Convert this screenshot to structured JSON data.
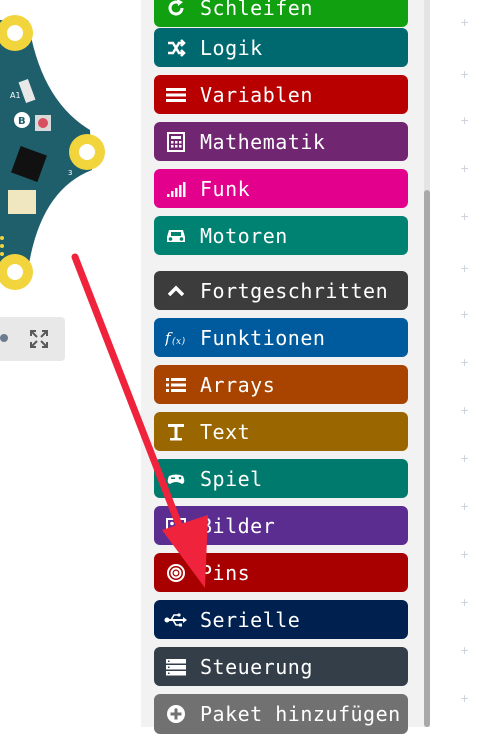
{
  "toolbox": {
    "categories": [
      {
        "label": "Schleifen",
        "icon": "loop-icon",
        "color": "#10a010"
      },
      {
        "label": "Logik",
        "icon": "shuffle-icon",
        "color": "#006970"
      },
      {
        "label": "Variablen",
        "icon": "list-lines-icon",
        "color": "#b80000"
      },
      {
        "label": "Mathematik",
        "icon": "calculator-icon",
        "color": "#712672"
      },
      {
        "label": "Funk",
        "icon": "signal-bars-icon",
        "color": "#e3008c"
      },
      {
        "label": "Motoren",
        "icon": "car-icon",
        "color": "#008272"
      },
      {
        "label": "Fortgeschritten",
        "icon": "chevron-up-icon",
        "color": "#3c3c3c"
      },
      {
        "label": "Funktionen",
        "icon": "function-icon",
        "color": "#005a9e"
      },
      {
        "label": "Arrays",
        "icon": "numbered-list-icon",
        "color": "#a94400"
      },
      {
        "label": "Text",
        "icon": "text-icon",
        "color": "#996600"
      },
      {
        "label": "Spiel",
        "icon": "gamepad-icon",
        "color": "#007a6c"
      },
      {
        "label": "Bilder",
        "icon": "image-icon",
        "color": "#5c2d91"
      },
      {
        "label": "Pins",
        "icon": "target-icon",
        "color": "#a80000"
      },
      {
        "label": "Serielle",
        "icon": "usb-icon",
        "color": "#002050"
      },
      {
        "label": "Steuerung",
        "icon": "server-icon",
        "color": "#333e48"
      },
      {
        "label": "Paket hinzufügen",
        "icon": "plus-circle-icon",
        "color": "#717171"
      }
    ]
  },
  "simulator": {
    "board_labels": {
      "a1": "A1",
      "b": "B",
      "three": "3"
    },
    "accent": "#1f5f6b",
    "fullscreen_icon": "fullscreen-icon"
  },
  "annotation": {
    "arrow_color": "#f0233c"
  }
}
